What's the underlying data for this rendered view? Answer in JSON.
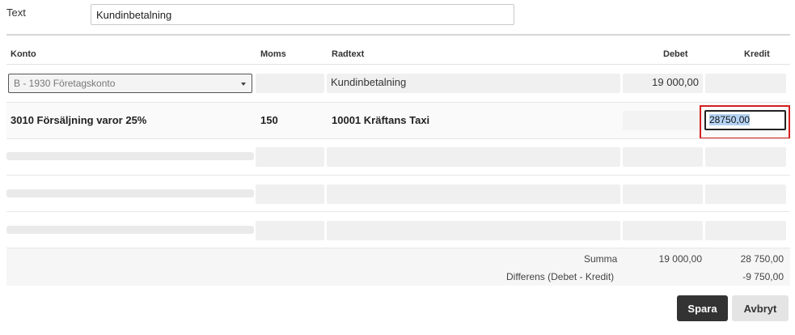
{
  "form": {
    "text_label": "Text",
    "text_value": "Kundinbetalning"
  },
  "table": {
    "headers": {
      "konto": "Konto",
      "moms": "Moms",
      "radtext": "Radtext",
      "debet": "Debet",
      "kredit": "Kredit"
    },
    "row1": {
      "konto_selected": "B - 1930 Företagskonto",
      "moms": "",
      "radtext": "Kundinbetalning",
      "debet": "19 000,00",
      "kredit": ""
    },
    "row2": {
      "konto": "3010 Försäljning varor 25%",
      "moms": "150",
      "radtext": "10001 Kräftans Taxi",
      "debet": "",
      "kredit_input": "28750,00"
    }
  },
  "summary": {
    "summa_label": "Summa",
    "summa_debet": "19 000,00",
    "summa_kredit": "28 750,00",
    "diff_label": "Differens (Debet - Kredit)",
    "diff_value": "-9 750,00"
  },
  "buttons": {
    "save": "Spara",
    "cancel": "Avbryt"
  },
  "colors": {
    "highlight_frame": "#d41f1f",
    "primary_button": "#333333",
    "selection": "#b5d3f5"
  }
}
